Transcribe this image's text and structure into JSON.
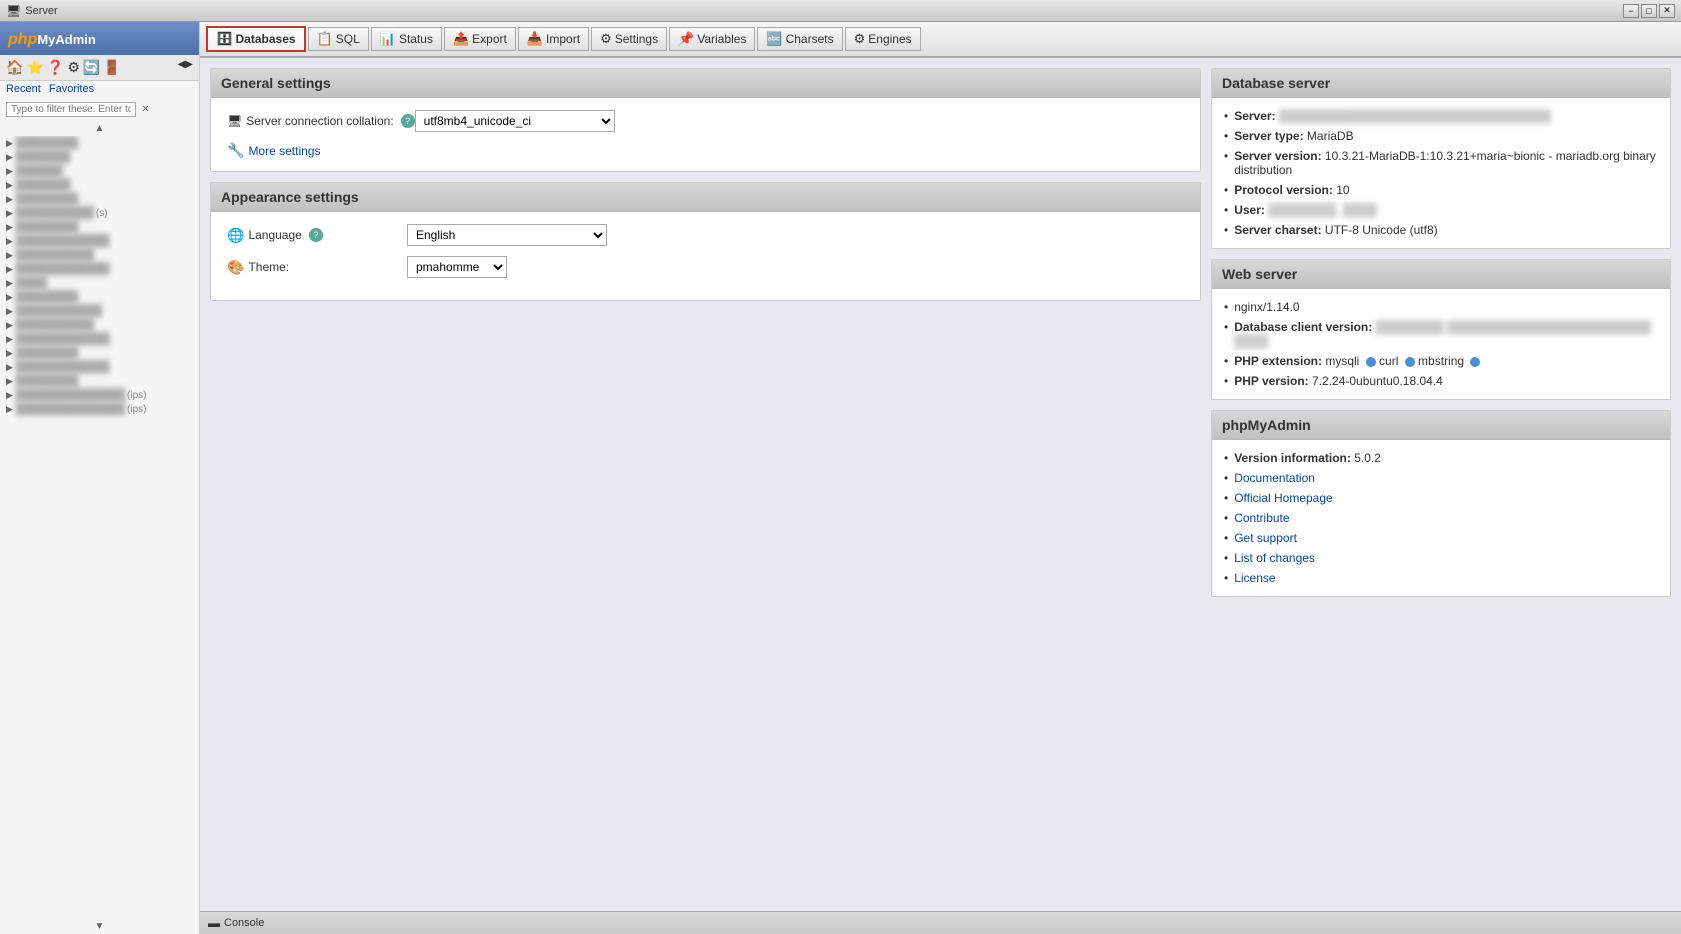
{
  "titlebar": {
    "title": "Server",
    "minimize": "−",
    "maximize": "□",
    "close": "✕"
  },
  "sidebar": {
    "logo_php": "php",
    "logo_rest": "MyAdmin",
    "recent_label": "Recent",
    "favorites_label": "Favorites",
    "filter_placeholder": "Type to filter these. Enter to",
    "filter_x": "✕",
    "scroll_up": "▲",
    "scroll_down": "▼",
    "databases": [
      {
        "name": "████████",
        "tag": ""
      },
      {
        "name": "███████",
        "tag": ""
      },
      {
        "name": "██████",
        "tag": ""
      },
      {
        "name": "███████",
        "tag": ""
      },
      {
        "name": "████████",
        "tag": ""
      },
      {
        "name": "██████████",
        "tag": "(s)"
      },
      {
        "name": "████████",
        "tag": ""
      },
      {
        "name": "████████████",
        "tag": ""
      },
      {
        "name": "██████████",
        "tag": ""
      },
      {
        "name": "████████████",
        "tag": ""
      },
      {
        "name": "████",
        "tag": ""
      },
      {
        "name": "████████",
        "tag": ""
      },
      {
        "name": "███████████",
        "tag": ""
      },
      {
        "name": "██████████",
        "tag": ""
      },
      {
        "name": "████████████",
        "tag": ""
      },
      {
        "name": "████████",
        "tag": ""
      },
      {
        "name": "████████████",
        "tag": ""
      },
      {
        "name": "████████",
        "tag": ""
      },
      {
        "name": "██████████████",
        "tag": "(ips)"
      },
      {
        "name": "██████████████",
        "tag": "(ips)"
      }
    ]
  },
  "toolbar": {
    "tabs": [
      {
        "id": "databases",
        "icon": "🗄",
        "label": "Databases",
        "active": true
      },
      {
        "id": "sql",
        "icon": "📋",
        "label": "SQL",
        "active": false
      },
      {
        "id": "status",
        "icon": "📊",
        "label": "Status",
        "active": false
      },
      {
        "id": "export",
        "icon": "📤",
        "label": "Export",
        "active": false
      },
      {
        "id": "import",
        "icon": "📥",
        "label": "Import",
        "active": false
      },
      {
        "id": "settings",
        "icon": "⚙",
        "label": "Settings",
        "active": false
      },
      {
        "id": "variables",
        "icon": "📌",
        "label": "Variables",
        "active": false
      },
      {
        "id": "charsets",
        "icon": "🔤",
        "label": "Charsets",
        "active": false
      },
      {
        "id": "engines",
        "icon": "⚙",
        "label": "Engines",
        "active": false
      }
    ]
  },
  "general_settings": {
    "title": "General settings",
    "collation_label": "Server connection collation:",
    "collation_help": "?",
    "collation_value": "utf8mb4_unicode_ci",
    "more_settings_label": "More settings"
  },
  "appearance_settings": {
    "title": "Appearance settings",
    "language_label": "Language",
    "language_help": "?",
    "language_value": "English",
    "theme_label": "Theme:",
    "theme_value": "pmahomme"
  },
  "database_server": {
    "title": "Database server",
    "items": [
      {
        "label": "Server:",
        "value": "████████████████████████████████"
      },
      {
        "label": "Server type:",
        "value": "MariaDB"
      },
      {
        "label": "Server version:",
        "value": "10.3.21-MariaDB-1:10.3.21+maria~bionic - mariadb.org binary distribution"
      },
      {
        "label": "Protocol version:",
        "value": "10"
      },
      {
        "label": "User:",
        "value": "████████_████"
      },
      {
        "label": "Server charset:",
        "value": "UTF-8 Unicode (utf8)"
      }
    ]
  },
  "web_server": {
    "title": "Web server",
    "items": [
      {
        "label": "nginx/1.14.0",
        "value": ""
      },
      {
        "label": "Database client version:",
        "value": "████████ ████████████████████████ ████"
      },
      {
        "label": "PHP extension:",
        "value": "mysqli"
      },
      {
        "label": "PHP version:",
        "value": "7.2.24-0ubuntu0.18.04.4"
      }
    ],
    "extensions": [
      "mysqli",
      "curl",
      "mbstring"
    ]
  },
  "phpmyadmin": {
    "title": "phpMyAdmin",
    "items": [
      {
        "label": "Version information:",
        "value": "5.0.2"
      },
      {
        "label": "Documentation",
        "link": true
      },
      {
        "label": "Official Homepage",
        "link": true
      },
      {
        "label": "Contribute",
        "link": true
      },
      {
        "label": "Get support",
        "link": true
      },
      {
        "label": "List of changes",
        "link": true
      },
      {
        "label": "License",
        "link": true
      }
    ]
  },
  "console": {
    "label": "Console"
  }
}
